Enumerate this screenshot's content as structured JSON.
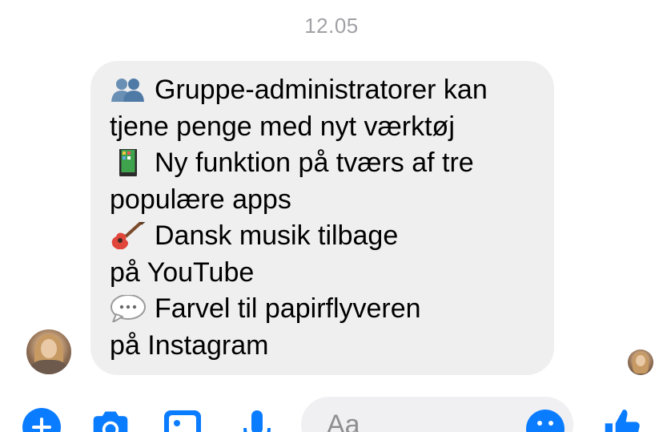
{
  "header": {
    "timestamp": "12.05"
  },
  "message": {
    "lines": [
      {
        "emoji": "people-icon",
        "text": "Gruppe-administratorer kan"
      },
      {
        "emoji": null,
        "text": "tjene penge med nyt værktøj"
      },
      {
        "emoji": "phone-icon",
        "text": "Ny funktion på tværs af tre"
      },
      {
        "emoji": null,
        "text": "populære apps"
      },
      {
        "emoji": "guitar-icon",
        "text": "Dansk musik tilbage"
      },
      {
        "emoji": null,
        "text": "på YouTube"
      },
      {
        "emoji": "speech-bubble-icon",
        "text": "Farvel til papirflyveren"
      },
      {
        "emoji": null,
        "text": "på Instagram"
      }
    ]
  },
  "composer": {
    "placeholder": "Aa"
  },
  "toolbar": {
    "icons": [
      "plus-icon",
      "camera-icon",
      "photo-icon",
      "microphone-icon",
      "emoji-icon",
      "thumbs-up-icon"
    ]
  },
  "colors": {
    "accent": "#0a7cff",
    "bubble": "#efeff0",
    "timestamp": "#a1a1a6"
  }
}
